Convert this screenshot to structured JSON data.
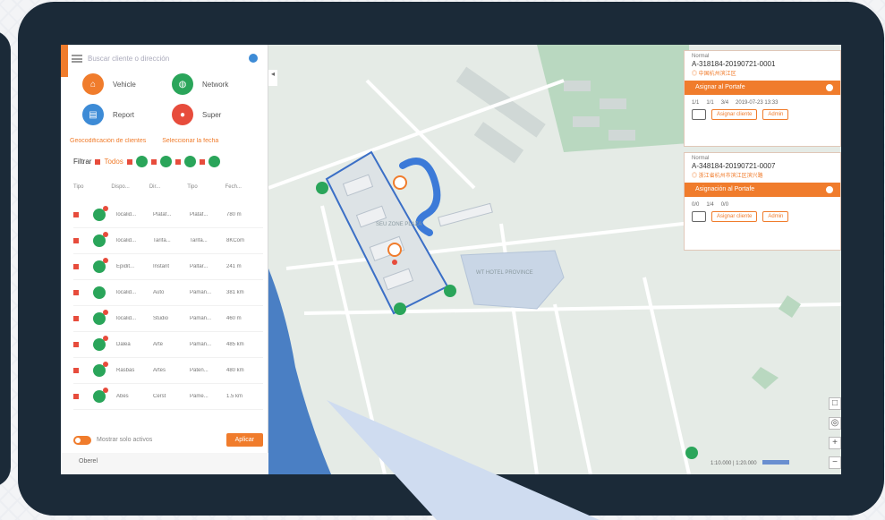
{
  "sidebar": {
    "search": {
      "placeholder": "Buscar cliente o dirección"
    },
    "categories": [
      {
        "label": "Vehicle",
        "icon": "house-icon",
        "color": "#f07c2c"
      },
      {
        "label": "Network",
        "icon": "globe-icon",
        "color": "#2aa55a"
      },
      {
        "label": "Report",
        "icon": "chat-icon",
        "color": "#3d8bd6"
      },
      {
        "label": "Super",
        "icon": "user-icon",
        "color": "#e74c3c"
      }
    ],
    "links": [
      "Geocodificación de clientes",
      "Seleccionar la fecha"
    ],
    "filter_label": "Filtrar",
    "filter_option": "Todos",
    "columns": [
      "Tipo",
      "Dispo...",
      "Dir...",
      "Tipo",
      "Fech..."
    ],
    "rows": [
      [
        "localid...",
        "Plataf...",
        "Plataf...",
        "780 m"
      ],
      [
        "localid...",
        "Tarifa...",
        "Tarifa...",
        "8KCom"
      ],
      [
        "Epidit...",
        "Instant",
        "Paltar...",
        "241 m"
      ],
      [
        "localid...",
        "Auto",
        "Paman...",
        "381 km"
      ],
      [
        "localid...",
        "Studio",
        "Paman...",
        "460 m"
      ],
      [
        "Dalea",
        "Arte",
        "Paman...",
        "485 km"
      ],
      [
        "Rasbas",
        "Artes",
        "Paten...",
        "480 km"
      ],
      [
        "Abes",
        "Cerst",
        "Pame...",
        "1.5 km"
      ]
    ],
    "toggle_label": "Mostrar solo activos",
    "apply_button": "Aplicar",
    "footer": "Oberel"
  },
  "map": {
    "labels": [
      "SEU ZONE PLAZA",
      "WT HOTEL PROVINCE"
    ],
    "scale": "1:10.000 | 1:20.000"
  },
  "cards": [
    {
      "status": "Normal",
      "id": "A-318184-20190721-0001",
      "address": "◎ 中国杭州滨江区",
      "action": "Asignar al Portafe",
      "stats": [
        "1/1",
        "1/1",
        "3/4",
        "2019-07-23 13:33"
      ],
      "buttons": [
        "Asignar cliente",
        "Admin"
      ]
    },
    {
      "status": "Normal",
      "id": "A-348184-20190721-0007",
      "address": "◎ 浙江省杭州市滨江区滨兴路",
      "action": "Asignación al Portafe",
      "stats": [
        "0/0",
        "1/4",
        "0/0"
      ],
      "buttons": [
        "Asignar cliente",
        "Admin"
      ]
    }
  ],
  "colors": {
    "accent": "#f07c2c",
    "frame": "#1b2a38",
    "water": "#4a7fc4",
    "marker_green": "#2aa55a"
  }
}
